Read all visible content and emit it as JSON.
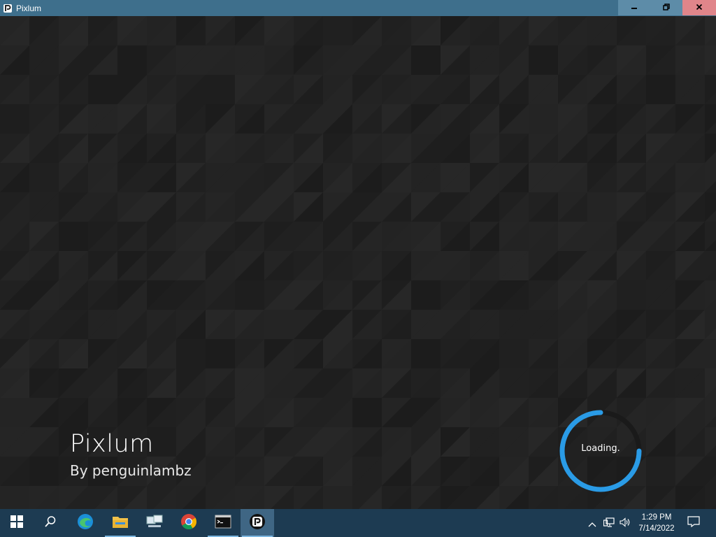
{
  "window": {
    "title": "Pixlum",
    "controls": {
      "minimize_icon": "minimize-icon",
      "maximize_icon": "restore-icon",
      "close_icon": "close-icon"
    }
  },
  "splash": {
    "title": "Pixlum",
    "author": "By penguinlambz",
    "loading_text": "Loading.",
    "accent": "#2a9be6",
    "background": "#222222"
  },
  "taskbar": {
    "items": [
      {
        "name": "start",
        "icon": "windows-start-icon"
      },
      {
        "name": "search",
        "icon": "search-icon"
      },
      {
        "name": "edge",
        "icon": "edge-browser-icon"
      },
      {
        "name": "file-explorer",
        "icon": "folder-icon"
      },
      {
        "name": "network-app",
        "icon": "network-computers-icon"
      },
      {
        "name": "chrome",
        "icon": "chrome-icon"
      },
      {
        "name": "terminal",
        "icon": "command-prompt-icon"
      },
      {
        "name": "pixlum",
        "icon": "pixlum-icon"
      }
    ],
    "tray": {
      "time": "1:29 PM",
      "date": "7/14/2022"
    },
    "color": "#1d3b52"
  }
}
